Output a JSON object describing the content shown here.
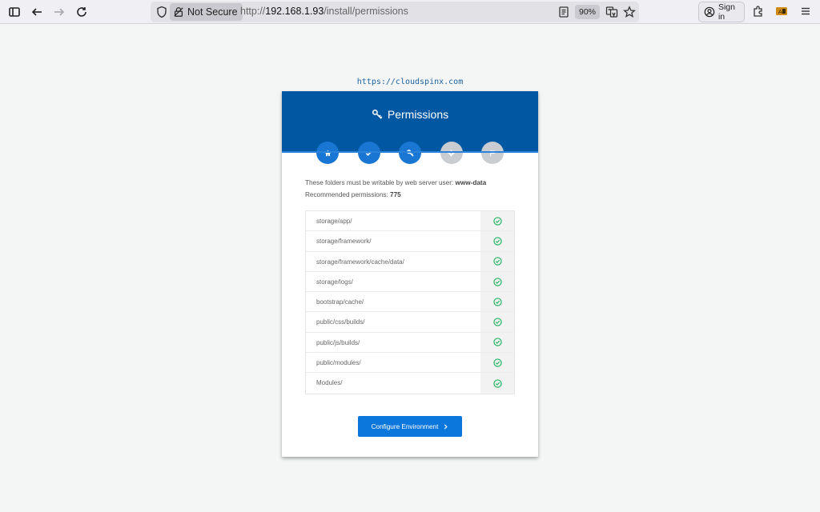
{
  "browser": {
    "not_secure_label": "Not Secure",
    "url_prefix": "http://",
    "url_host": "192.168.1.93",
    "url_path": "/install/permissions",
    "zoom": "90%",
    "sign_in_label": "Sign in"
  },
  "page": {
    "site_link": "https://cloudspinx.com",
    "title": "Permissions",
    "steps": [
      {
        "icon": "home-icon",
        "status": "done"
      },
      {
        "icon": "check-icon",
        "status": "done"
      },
      {
        "icon": "key-icon",
        "status": "done"
      },
      {
        "icon": "gear-icon",
        "status": "todo"
      },
      {
        "icon": "flag-icon",
        "status": "todo"
      }
    ],
    "info_line1_prefix": "These folders must be writable by web server user:",
    "web_user": "www-data",
    "info_line2_prefix": "Recommended permissions:",
    "recommended_permissions": "775",
    "folders": [
      {
        "path": "storage/app/",
        "ok": true
      },
      {
        "path": "storage/framework/",
        "ok": true
      },
      {
        "path": "storage/framework/cache/data/",
        "ok": true
      },
      {
        "path": "storage/logs/",
        "ok": true
      },
      {
        "path": "bootstrap/cache/",
        "ok": true
      },
      {
        "path": "public/css/builds/",
        "ok": true
      },
      {
        "path": "public/js/builds/",
        "ok": true
      },
      {
        "path": "public/modules/",
        "ok": true
      },
      {
        "path": "Modules/",
        "ok": true
      }
    ],
    "next_button_label": "Configure Environment"
  },
  "colors": {
    "header_blue": "#0058a3",
    "step_done": "#1976d2",
    "step_todo": "#c9cdd1",
    "check_green": "#22b35e",
    "button_blue": "#0b76db"
  }
}
